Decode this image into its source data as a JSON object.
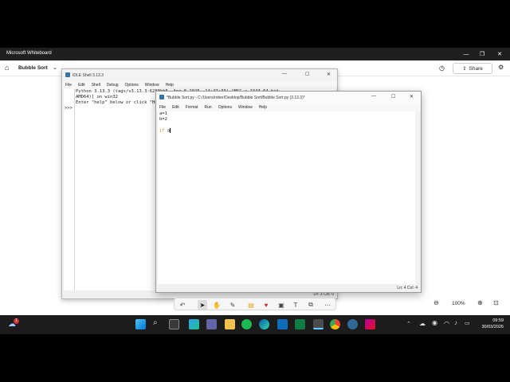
{
  "app": {
    "title": "Microsoft Whiteboard",
    "board_name": "Bubble Sort",
    "share_label": "Share"
  },
  "zoom": {
    "level": "100%"
  },
  "shell": {
    "title": "IDLE Shell 3.13.3",
    "menu": [
      "File",
      "Edit",
      "Shell",
      "Debug",
      "Options",
      "Window",
      "Help"
    ],
    "lines": [
      "Python 3.13.3 (tags/v3.13.3:6280bb5, Apr  8 2025, 14:47:33) [MSC v.1943 64 bit",
      "AMD64)] on win32",
      "Enter \"help\" below or click \"Help\" above for more information."
    ],
    "prompt": ">>>",
    "status": "Ln: 3  Col: 0"
  },
  "editor": {
    "title": "*Bubble Sort.py - C:/Users/rober/Desktop/Bubble Sort/Bubble Sort.py (3.13.3)*",
    "menu": [
      "File",
      "Edit",
      "Format",
      "Run",
      "Options",
      "Window",
      "Help"
    ],
    "line1": "a=1",
    "line2": "b=2",
    "line4_keyword": "if",
    "line4_rest": " a",
    "status": "Ln: 4  Col: 4"
  },
  "taskbar": {
    "time": "09:59",
    "date": "30/03/2026",
    "notification_count": "1"
  },
  "colors": {
    "keyword": "#ff7700",
    "accent": "#0067c0"
  }
}
